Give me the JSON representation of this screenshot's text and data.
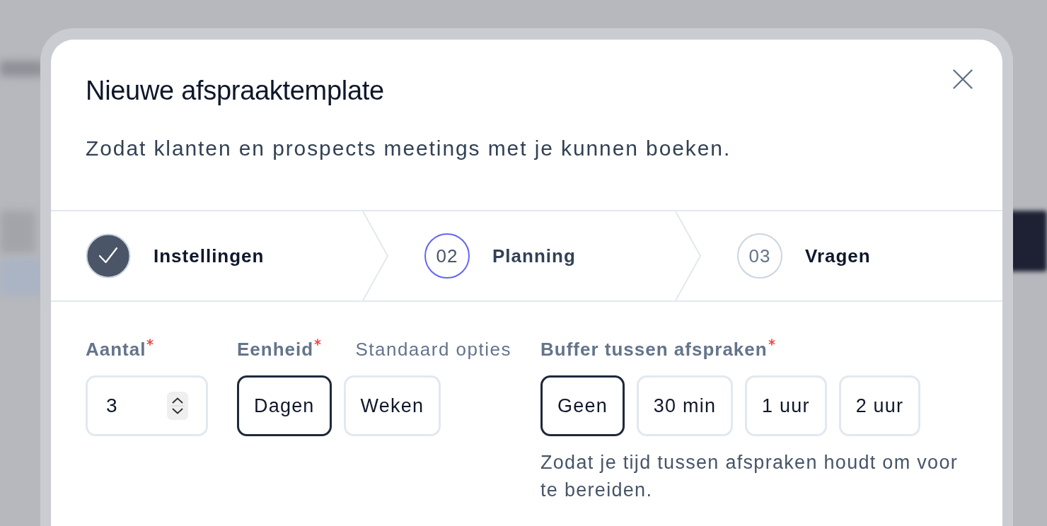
{
  "dialog": {
    "title": "Nieuwe afspraaktemplate",
    "subtitle": "Zodat klanten en prospects meetings met je kunnen boeken."
  },
  "steps": [
    {
      "label": "Instellingen",
      "completed": true,
      "selected": false
    },
    {
      "number": "02",
      "label": "Planning",
      "completed": false,
      "selected": true
    },
    {
      "number": "03",
      "label": "Vragen",
      "completed": false,
      "selected": false
    }
  ],
  "amount": {
    "label": "Aantal",
    "required": true,
    "value": "3"
  },
  "unit": {
    "label": "Eenheid",
    "required": true,
    "hint": "Standaard opties",
    "options": [
      {
        "label": "Dagen",
        "selected": true
      },
      {
        "label": "Weken",
        "selected": false
      }
    ]
  },
  "buffer": {
    "label": "Buffer tussen afspraken",
    "required": true,
    "options": [
      {
        "label": "Geen",
        "selected": true
      },
      {
        "label": "30 min",
        "selected": false
      },
      {
        "label": "1 uur",
        "selected": false
      },
      {
        "label": "2 uur",
        "selected": false
      }
    ],
    "help": "Zodat je tijd tussen afspraken houdt om voor te bereiden."
  }
}
